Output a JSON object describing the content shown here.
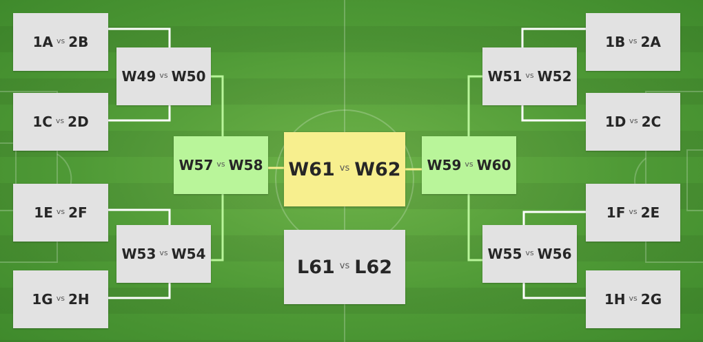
{
  "vs_label": "vs",
  "colors": {
    "match_box": "#e2e2e2",
    "semifinal_box": "#b9f59a",
    "final_box": "#f7ef8e",
    "connector_group": "#ffffff",
    "connector_semifinal": "#b9f59a",
    "connector_final": "#f7ef8e"
  },
  "left": {
    "round_of_16": [
      {
        "home": "1A",
        "away": "2B"
      },
      {
        "home": "1C",
        "away": "2D"
      },
      {
        "home": "1E",
        "away": "2F"
      },
      {
        "home": "1G",
        "away": "2H"
      }
    ],
    "quarterfinals": [
      {
        "home": "W49",
        "away": "W50"
      },
      {
        "home": "W53",
        "away": "W54"
      }
    ],
    "semifinal": {
      "home": "W57",
      "away": "W58"
    }
  },
  "right": {
    "round_of_16": [
      {
        "home": "1B",
        "away": "2A"
      },
      {
        "home": "1D",
        "away": "2C"
      },
      {
        "home": "1F",
        "away": "2E"
      },
      {
        "home": "1H",
        "away": "2G"
      }
    ],
    "quarterfinals": [
      {
        "home": "W51",
        "away": "W52"
      },
      {
        "home": "W55",
        "away": "W56"
      }
    ],
    "semifinal": {
      "home": "W59",
      "away": "W60"
    }
  },
  "final": {
    "home": "W61",
    "away": "W62"
  },
  "third_place": {
    "home": "L61",
    "away": "L62"
  }
}
